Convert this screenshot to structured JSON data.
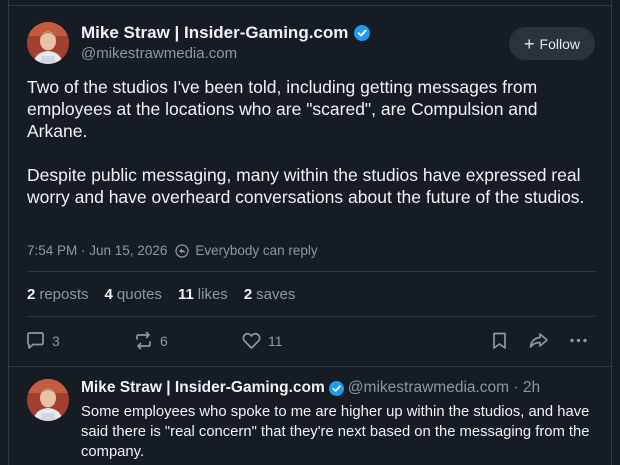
{
  "main_post": {
    "author_name": "Mike Straw | Insider-Gaming.com",
    "handle": "@mikestrawmedia.com",
    "follow_label": "Follow",
    "paragraphs": [
      "Two of the studios I've been told, including getting messages from employees at the locations who are \"scared\", are Compulsion and Arkane.",
      "Despite public messaging, many within the studios have expressed real worry and have overheard conversations about the future of the studios."
    ],
    "timestamp": "7:54 PM · Jun 15, 2026",
    "reply_setting": "Everybody can reply",
    "stats": [
      {
        "count": "2",
        "label": "reposts"
      },
      {
        "count": "4",
        "label": "quotes"
      },
      {
        "count": "11",
        "label": "likes"
      },
      {
        "count": "2",
        "label": "saves"
      }
    ],
    "actions": {
      "reply_count": "3",
      "repost_count": "6",
      "like_count": "11"
    }
  },
  "reply_post": {
    "author_name": "Mike Straw | Insider-Gaming.com",
    "handle_time": "@mikestrawmedia.com · 2h",
    "text": "Some employees who spoke to me are higher up within the studios, and have said there is \"real concern\" that they're next based on the messaging from the company."
  },
  "colors": {
    "background": "#151c24",
    "verified_blue": "#1d9bf0",
    "muted_text": "#8b98a5",
    "border": "#2f3943"
  },
  "icons": [
    "verified-badge-icon",
    "reply-setting-icon",
    "reply-icon",
    "repost-icon",
    "like-icon",
    "bookmark-icon",
    "share-icon",
    "more-icon"
  ]
}
